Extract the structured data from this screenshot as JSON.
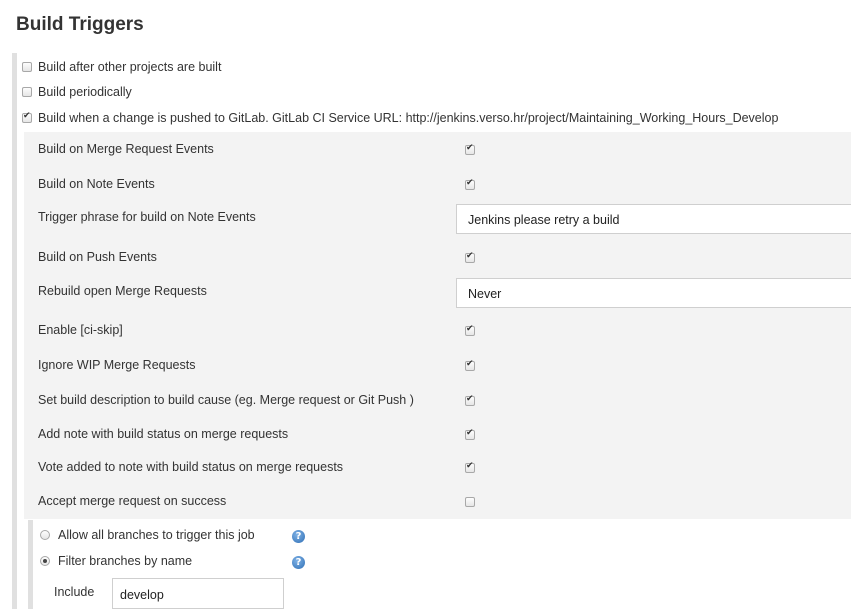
{
  "section_title": "Build Triggers",
  "top_options": [
    {
      "label": "Build after other projects are built",
      "checked": false
    },
    {
      "label": "Build periodically",
      "checked": false
    },
    {
      "label": "Build when a change is pushed to GitLab. GitLab CI Service URL: http://jenkins.verso.hr/project/Maintaining_Working_Hours_Develop",
      "checked": true
    }
  ],
  "gitlab_options": {
    "merge_request_events": {
      "label": "Build on Merge Request Events",
      "checked": true
    },
    "note_events": {
      "label": "Build on Note Events",
      "checked": true
    },
    "trigger_phrase": {
      "label": "Trigger phrase for build on Note Events",
      "value": "Jenkins please retry a build"
    },
    "push_events": {
      "label": "Build on Push Events",
      "checked": true
    },
    "rebuild_open_mr": {
      "label": "Rebuild open Merge Requests",
      "value": "Never"
    },
    "ci_skip": {
      "label": "Enable [ci-skip]",
      "checked": true
    },
    "ignore_wip": {
      "label": "Ignore WIP Merge Requests",
      "checked": true
    },
    "set_description": {
      "label": "Set build description to build cause (eg. Merge request or Git Push )",
      "checked": true
    },
    "add_note": {
      "label": "Add note with build status on merge requests",
      "checked": true
    },
    "vote_added": {
      "label": "Vote added to note with build status on merge requests",
      "checked": true
    },
    "accept_mr": {
      "label": "Accept merge request on success",
      "checked": false
    }
  },
  "branch_filter": {
    "allow_all": {
      "label": "Allow all branches to trigger this job",
      "selected": false
    },
    "filter_by_name": {
      "label": "Filter branches by name",
      "selected": true
    },
    "include_label": "Include",
    "include_value": "develop"
  },
  "help_icon_glyph": "?",
  "icons": {
    "help": "help-icon"
  }
}
